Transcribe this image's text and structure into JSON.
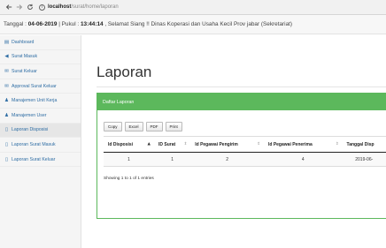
{
  "browser": {
    "back_icon": "arrow-left",
    "forward_icon": "arrow-right",
    "reload_icon": "reload",
    "info_icon": "info-circle",
    "url_host": "localhost",
    "url_path": "/surat/home/laporan"
  },
  "topbar": {
    "date_label": "Tanggal :",
    "date_value": "04-06-2019",
    "time_label": "| Pukul :",
    "time_value": "13:44:14",
    "greeting": ", Selamat Siang !! Dinas Koperasi dan Usaha Kecil Prov jabar (Sekretariat)"
  },
  "sidebar": {
    "items": [
      {
        "label": "Dashboard",
        "icon": "dashboard"
      },
      {
        "label": "Surat Masuk",
        "icon": "paper-plane"
      },
      {
        "label": "Surat Keluar",
        "icon": "envelope"
      },
      {
        "label": "Approval Surat Keluar",
        "icon": "envelope"
      },
      {
        "label": "Manajemen Unit Kerja",
        "icon": "user"
      },
      {
        "label": "Manajemen User",
        "icon": "user"
      },
      {
        "label": "Laporan Disposisi",
        "icon": "file"
      },
      {
        "label": "Laporan Surat Masuk",
        "icon": "file"
      },
      {
        "label": "Laporan Surat Keluar",
        "icon": "file"
      }
    ]
  },
  "main": {
    "title": "Laporan",
    "panel_title": "Daftar Laporan",
    "buttons": [
      "Copy",
      "Excel",
      "PDF",
      "Print"
    ],
    "columns": [
      "Id Disposisi",
      "ID Surat",
      "Id Pegawai Pengirim",
      "Id Pegawai Penerima",
      "Tanggal Disp"
    ],
    "rows": [
      [
        "1",
        "1",
        "2",
        "4",
        "2019-06-"
      ]
    ],
    "info": "Showing 1 to 1 of 1 entries"
  }
}
